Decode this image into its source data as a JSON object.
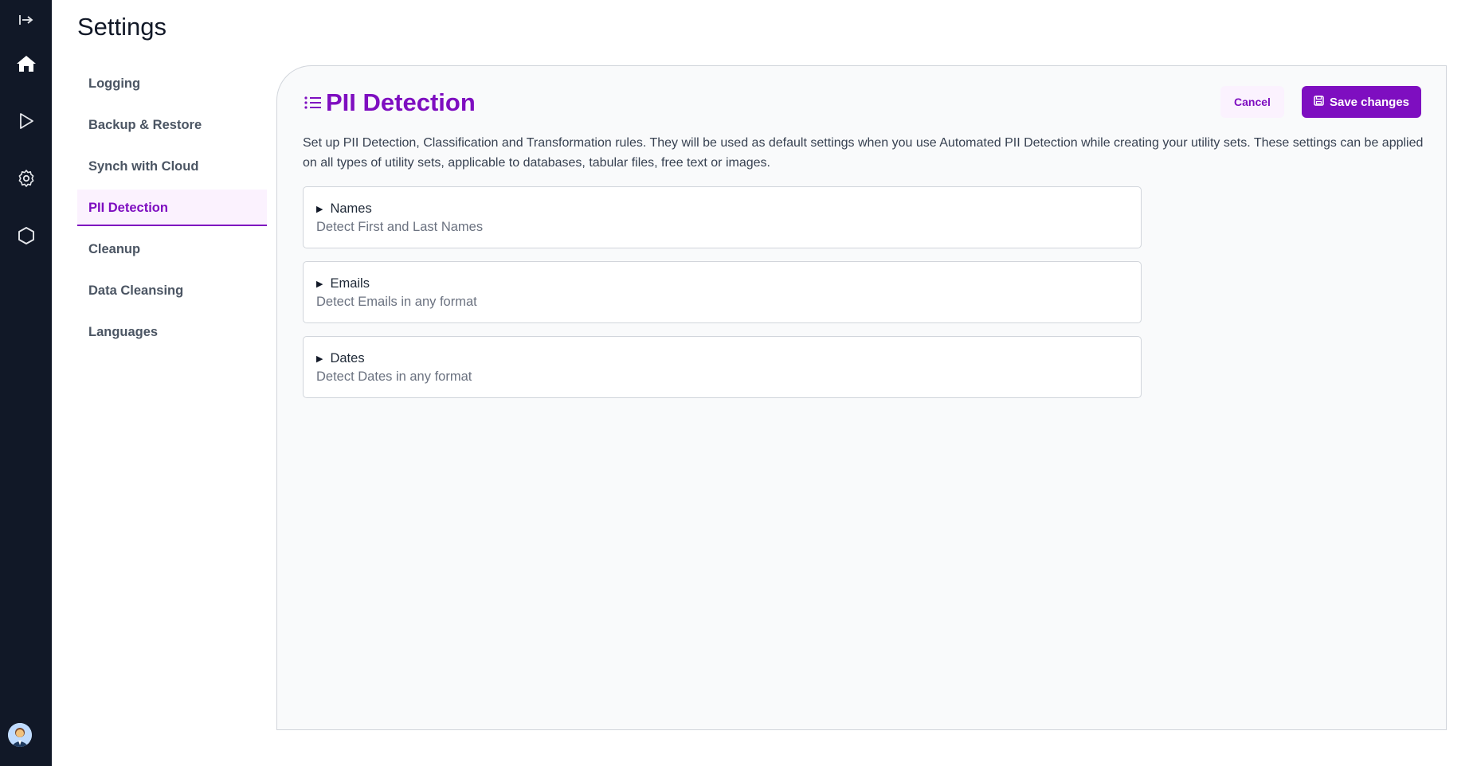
{
  "page": {
    "title": "Settings"
  },
  "nav": {
    "items": [
      {
        "label": "Logging"
      },
      {
        "label": "Backup & Restore"
      },
      {
        "label": "Synch with Cloud"
      },
      {
        "label": "PII Detection",
        "active": true
      },
      {
        "label": "Cleanup"
      },
      {
        "label": "Data Cleansing"
      },
      {
        "label": "Languages"
      }
    ]
  },
  "rail": {
    "icons": [
      "expand-arrow-icon",
      "home-icon",
      "play-icon",
      "gear-icon",
      "hexagon-icon",
      "user-avatar"
    ]
  },
  "panel": {
    "title": "PII Detection",
    "cancel_label": "Cancel",
    "save_label": "Save changes",
    "description": "Set up PII Detection, Classification and Transformation rules. They will be used as default settings when you use Automated PII Detection while creating your utility sets. These settings can be applied on all types of utility sets, applicable to databases, tabular files, free text or images.",
    "sections": [
      {
        "title": "Names",
        "subtitle": "Detect First and Last Names"
      },
      {
        "title": "Emails",
        "subtitle": "Detect Emails in any format"
      },
      {
        "title": "Dates",
        "subtitle": "Detect Dates in any format"
      }
    ]
  },
  "colors": {
    "accent": "#7e0ec0",
    "accent_light": "#fbf2fe",
    "rail_bg": "#111827"
  }
}
